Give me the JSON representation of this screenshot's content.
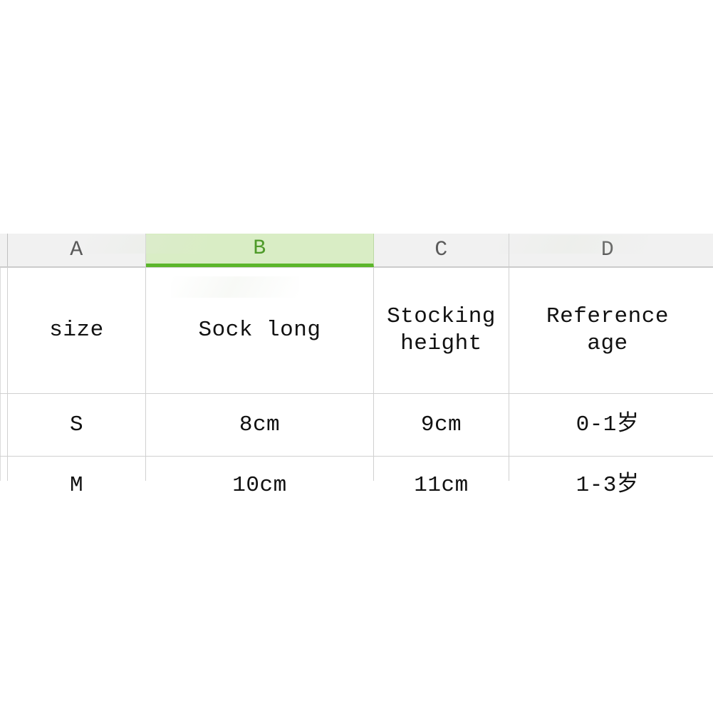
{
  "app": {
    "type": "spreadsheet",
    "background_color": "#ffffff"
  },
  "colors": {
    "header_bg": "#f1f1f1",
    "header_text": "#5a5a5a",
    "selected_header_bg": "#d9edc5",
    "selected_header_text": "#4f9b2a",
    "selected_underline": "#5cb62b",
    "gridline": "#d0d0d0",
    "cell_text": "#111111"
  },
  "column_headers": {
    "corner": "",
    "letters": [
      "A",
      "B",
      "C",
      "D"
    ],
    "selected_letter": "B"
  },
  "table": {
    "columns": [
      "size",
      "Sock long",
      "Stocking height",
      "Reference age"
    ],
    "header_row": {
      "a": "size",
      "b": "Sock long",
      "c": "Stocking\nheight",
      "d": "Reference\nage"
    },
    "rows": [
      {
        "size": "S",
        "sock_long": "8cm",
        "stocking_height": "9cm",
        "reference_age": "0-1岁"
      },
      {
        "size": "M",
        "sock_long": "10cm",
        "stocking_height": "11cm",
        "reference_age": "1-3岁"
      }
    ]
  },
  "chart_data": {
    "type": "table",
    "title": "",
    "columns": [
      "size",
      "Sock long",
      "Stocking height",
      "Reference age"
    ],
    "rows": [
      [
        "S",
        "8cm",
        "9cm",
        "0-1岁"
      ],
      [
        "M",
        "10cm",
        "11cm",
        "1-3岁"
      ]
    ],
    "numeric": {
      "sizes": [
        "S",
        "M"
      ],
      "sock_long_cm": [
        8,
        10
      ],
      "stocking_height_cm": [
        9,
        11
      ],
      "reference_age_years": [
        [
          0,
          1
        ],
        [
          1,
          3
        ]
      ]
    }
  }
}
